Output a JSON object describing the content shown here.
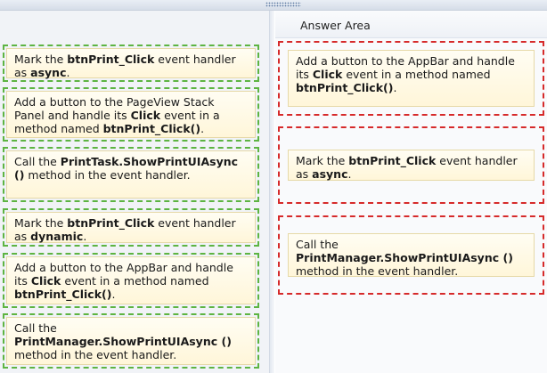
{
  "answer_area": {
    "title": "Answer Area"
  },
  "choices": [
    {
      "parts": [
        "Mark the ",
        "btnPrint_Click",
        " event handler as ",
        "async",
        "."
      ]
    },
    {
      "parts": [
        "Add a button to the PageView Stack Panel and handle its ",
        "Click",
        " event in a method named ",
        "btnPrint_Click()",
        "."
      ]
    },
    {
      "parts": [
        "Call the ",
        "PrintTask.ShowPrintUIAsync ()",
        " method in the event handler."
      ]
    },
    {
      "parts": [
        "Mark the ",
        "btnPrint_Click",
        " event handler as ",
        "dynamic",
        "."
      ]
    },
    {
      "parts": [
        "Add a button to the AppBar and handle its ",
        "Click",
        " event in a method named ",
        "btnPrint_Click()",
        "."
      ]
    },
    {
      "parts": [
        "Call the ",
        "PrintManager.ShowPrintUIAsync ()",
        " method in the event handler."
      ]
    }
  ],
  "answers": [
    {
      "parts": [
        "Add a button to the AppBar and handle its ",
        "Click",
        " event in a method named ",
        "btnPrint_Click()",
        "."
      ]
    },
    {
      "parts": [
        "Mark the ",
        "btnPrint_Click",
        " event handler as ",
        "async",
        "."
      ]
    },
    {
      "parts": [
        "Call the ",
        "PrintManager.ShowPrintUIAsync ()",
        " method in the event handler."
      ]
    }
  ]
}
